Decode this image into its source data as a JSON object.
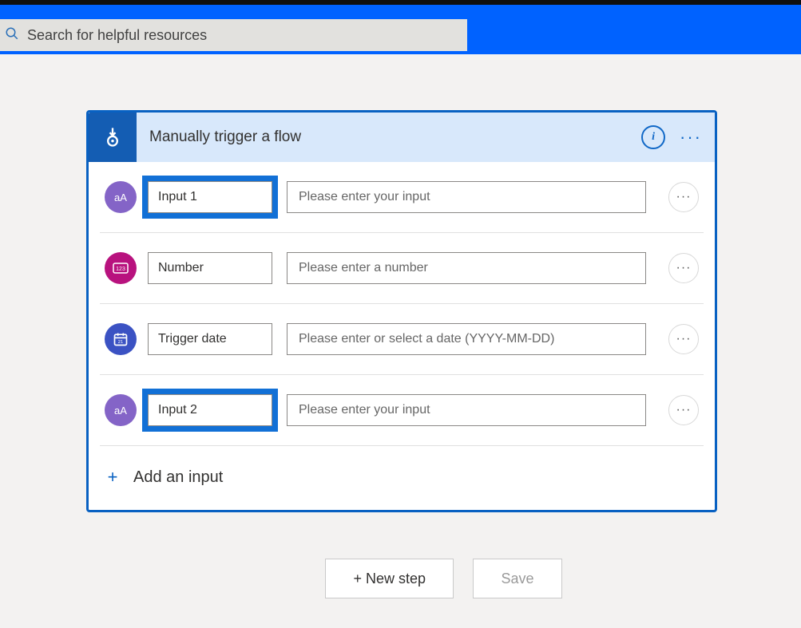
{
  "search": {
    "placeholder": "Search for helpful resources"
  },
  "card": {
    "title": "Manually trigger a flow",
    "rows": [
      {
        "name": "Input 1",
        "placeholder": "Please enter your input",
        "type": "text",
        "iconGlyph": "aA",
        "highlight": true
      },
      {
        "name": "Number",
        "placeholder": "Please enter a number",
        "type": "number",
        "iconGlyph": "123",
        "highlight": false
      },
      {
        "name": "Trigger date",
        "placeholder": "Please enter or select a date (YYYY-MM-DD)",
        "type": "date",
        "iconGlyph": "📅",
        "highlight": false
      },
      {
        "name": "Input 2",
        "placeholder": "Please enter your input",
        "type": "text",
        "iconGlyph": "aA",
        "highlight": true
      }
    ],
    "addInputLabel": "Add an input"
  },
  "footer": {
    "newStep": "+ New step",
    "save": "Save"
  }
}
